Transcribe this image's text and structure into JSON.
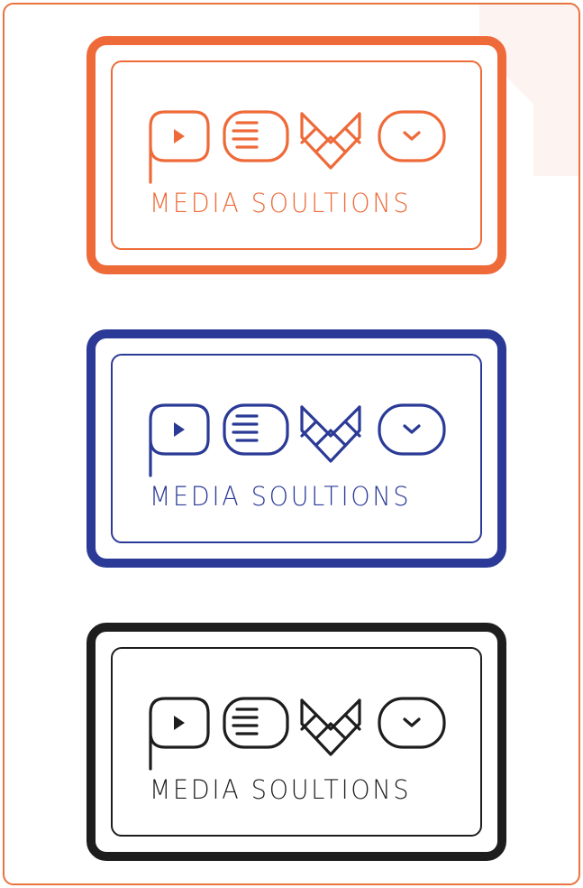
{
  "logos": [
    {
      "color": "#ee6a39",
      "tagline": "MEDIA SOULTIONS"
    },
    {
      "color": "#2b3a96",
      "tagline": "MEDIA SOULTIONS"
    },
    {
      "color": "#1d1d1d",
      "tagline": "MEDIA SOULTIONS"
    }
  ],
  "frame_color": "#e8743f",
  "icons": [
    "play-icon",
    "lines-icon",
    "chevron-shield-icon",
    "chevron-down-icon"
  ]
}
